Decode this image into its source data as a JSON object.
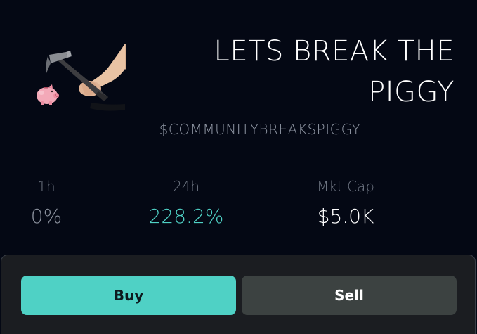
{
  "token": {
    "name_line1": "LETS BREAK THE",
    "name_line2": "PIGGY",
    "ticker": "$COMMUNITYBREAKSPIGGY",
    "image_icon": "piggy-bank-hammer-icon"
  },
  "stats": {
    "change_1h_label": "1h",
    "change_1h_value": "0%",
    "change_24h_label": "24h",
    "change_24h_value": "228.2%",
    "market_cap_label": "Mkt Cap",
    "market_cap_value": "$5.0K"
  },
  "actions": {
    "buy_label": "Buy",
    "sell_label": "Sell"
  },
  "colors": {
    "background": "#040814",
    "accent": "#4fd1c5",
    "sell_button": "#3c4241",
    "panel": "#1b1d21"
  }
}
